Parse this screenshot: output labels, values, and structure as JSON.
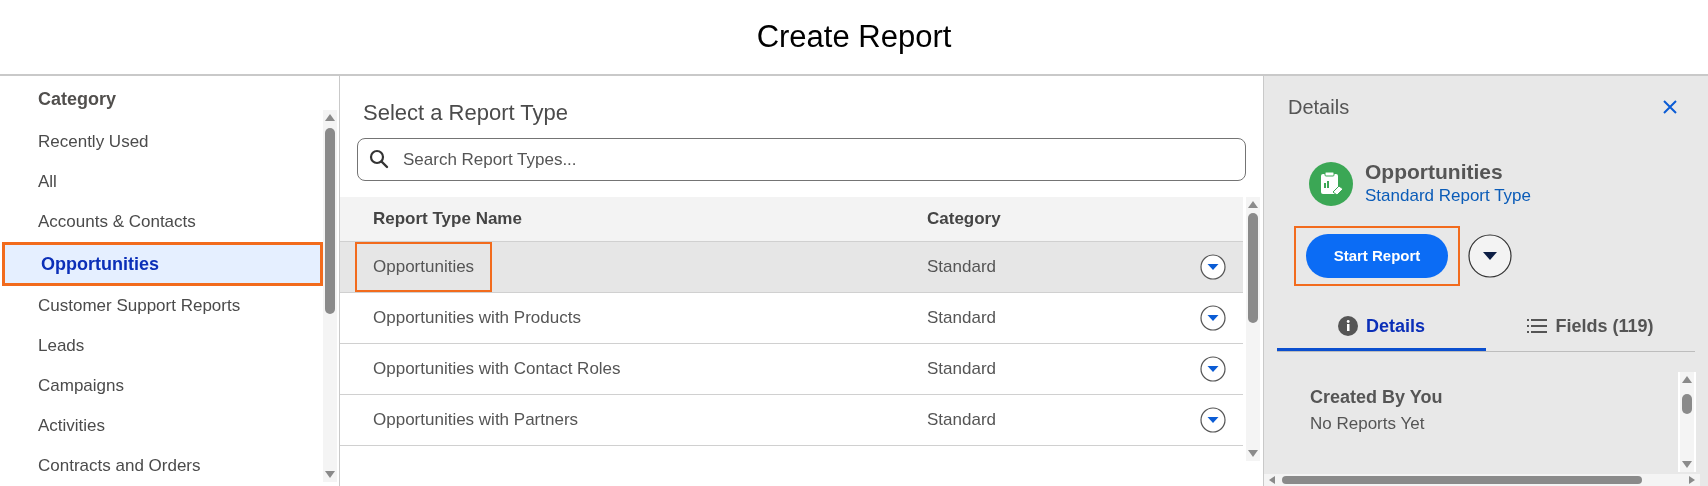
{
  "title": "Create Report",
  "sidebar": {
    "heading": "Category",
    "items": [
      {
        "label": "Recently Used",
        "selected": false
      },
      {
        "label": "All",
        "selected": false
      },
      {
        "label": "Accounts & Contacts",
        "selected": false
      },
      {
        "label": "Opportunities",
        "selected": true
      },
      {
        "label": "Customer Support Reports",
        "selected": false
      },
      {
        "label": "Leads",
        "selected": false
      },
      {
        "label": "Campaigns",
        "selected": false
      },
      {
        "label": "Activities",
        "selected": false
      },
      {
        "label": "Contracts and Orders",
        "selected": false
      }
    ]
  },
  "main": {
    "heading": "Select a Report Type",
    "search": {
      "placeholder": "Search Report Types..."
    },
    "table": {
      "columns": [
        "Report Type Name",
        "Category"
      ],
      "rows": [
        {
          "name": "Opportunities",
          "category": "Standard",
          "selected": true
        },
        {
          "name": "Opportunities with Products",
          "category": "Standard",
          "selected": false
        },
        {
          "name": "Opportunities with Contact Roles",
          "category": "Standard",
          "selected": false
        },
        {
          "name": "Opportunities with Partners",
          "category": "Standard",
          "selected": false
        }
      ]
    }
  },
  "details": {
    "title": "Details",
    "report": {
      "name": "Opportunities",
      "type": "Standard Report Type"
    },
    "start_button": {
      "label": "Start Report",
      "highlighted": true
    },
    "tabs": [
      {
        "label": "Details",
        "kind": "info",
        "selected": true
      },
      {
        "label": "Fields (119)",
        "kind": "list",
        "selected": false
      }
    ],
    "sections": [
      {
        "heading": "Created By You",
        "text": "No Reports Yet"
      }
    ]
  }
}
